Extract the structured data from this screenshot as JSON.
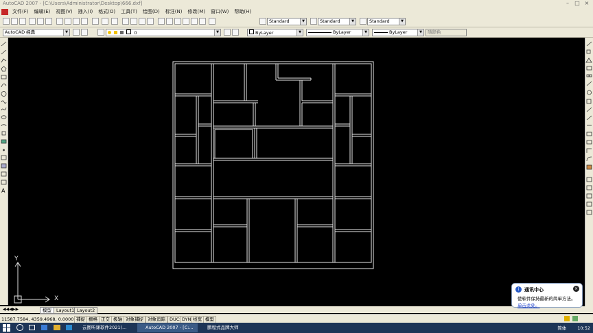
{
  "window": {
    "title": "AutoCAD 2007 - [C:\\Users\\Administrator\\Desktop\\666.dxf]",
    "min": "–",
    "max": "□",
    "close": "×"
  },
  "menu": [
    "文件(F)",
    "编辑(E)",
    "视图(V)",
    "插入(I)",
    "格式(O)",
    "工具(T)",
    "绘图(D)",
    "标注(N)",
    "修改(M)",
    "窗口(W)",
    "帮助(H)"
  ],
  "toolbar": {
    "text_style": "Standard",
    "dim_style": "Standard",
    "table_style": "Standard",
    "workspace": "AutoCAD 经典",
    "layer": "0",
    "color": "ByLayer",
    "linetype": "ByLayer",
    "lineweight": "ByLayer",
    "plotstyle": "随颜色"
  },
  "ucs": {
    "x": "X",
    "y": "Y"
  },
  "layout_tabs": {
    "model": "模型",
    "layout1": "Layout1",
    "layout2": "Layout2"
  },
  "status": {
    "coords": "11587.7584,  4359.4968,  0.0000",
    "buttons": [
      "捕捉",
      "栅格",
      "正交",
      "极轴",
      "对象捕捉",
      "对象追踪",
      "DUCS",
      "DYN",
      "线宽",
      "模型"
    ]
  },
  "popup": {
    "title": "通讯中心",
    "message": "使软件保持最新的简单方法。",
    "link": "单击此处。"
  },
  "taskbar": {
    "items": [
      "云图听课软件2021(...",
      "AutoCAD 2007 - [C:...",
      "鹏程式品牌大师"
    ],
    "lang": "简体",
    "time": "10:52"
  }
}
